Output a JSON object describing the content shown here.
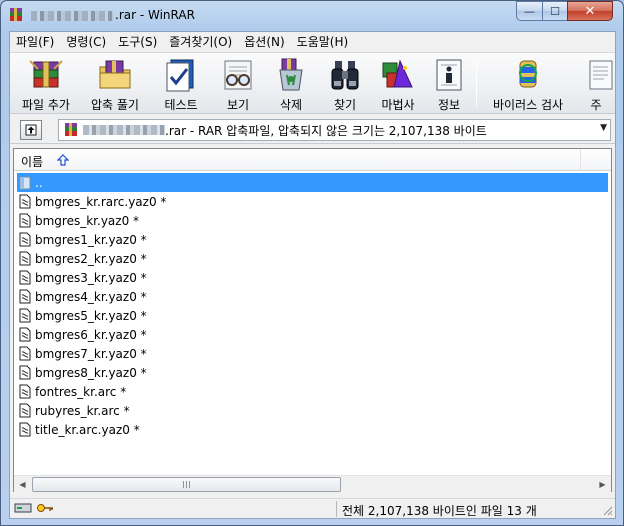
{
  "window": {
    "title": ".rar - WinRAR",
    "controls": {
      "minimize": "—",
      "maximize": "☐",
      "close": "✕"
    }
  },
  "menu": [
    "파일(F)",
    "명령(C)",
    "도구(S)",
    "즐겨찾기(O)",
    "옵션(N)",
    "도움말(H)"
  ],
  "toolbar": {
    "add": "파일 추가",
    "extract": "압축 풀기",
    "test": "테스트",
    "view": "보기",
    "delete": "삭제",
    "find": "찾기",
    "wizard": "마법사",
    "info": "정보",
    "virusscan": "바이러스 검사",
    "comment": "주"
  },
  "address": {
    "text": ".rar - RAR 압축파일, 압축되지 않은 크기는 2,107,138 바이트"
  },
  "list": {
    "column_name": "이름",
    "parent": "..",
    "files": [
      "bmgres_kr.rarc.yaz0 *",
      "bmgres_kr.yaz0 *",
      "bmgres1_kr.yaz0 *",
      "bmgres2_kr.yaz0 *",
      "bmgres3_kr.yaz0 *",
      "bmgres4_kr.yaz0 *",
      "bmgres5_kr.yaz0 *",
      "bmgres6_kr.yaz0 *",
      "bmgres7_kr.yaz0 *",
      "bmgres8_kr.yaz0 *",
      "fontres_kr.arc *",
      "rubyres_kr.arc *",
      "title_kr.arc.yaz0 *"
    ]
  },
  "scrollbar": {
    "left": "◀",
    "right": "▶"
  },
  "status": {
    "text": "전체 2,107,138 바이트인 파일 13 개"
  }
}
